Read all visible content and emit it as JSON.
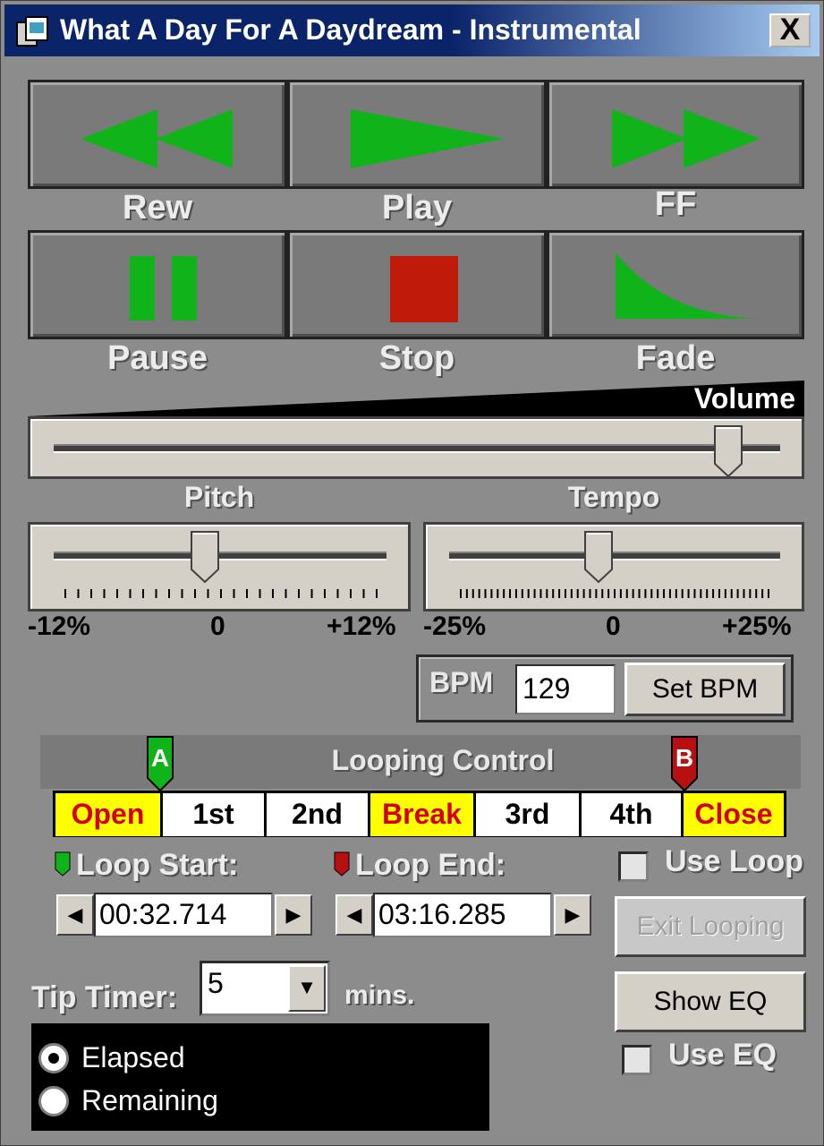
{
  "window": {
    "title": "What A Day For A Daydream - Instrumental",
    "close_label": "X"
  },
  "transport": {
    "rew_label": "Rew",
    "play_label": "Play",
    "ff_label": "FF",
    "pause_label": "Pause",
    "stop_label": "Stop",
    "fade_label": "Fade"
  },
  "volume": {
    "label": "Volume",
    "level": 0.97
  },
  "pitch": {
    "label": "Pitch",
    "min_label": "-12%",
    "mid_label": "0",
    "max_label": "+12%",
    "level": 0.5
  },
  "tempo": {
    "label": "Tempo",
    "min_label": "-25%",
    "mid_label": "0",
    "max_label": "+25%",
    "level": 0.5
  },
  "bpm": {
    "label": "BPM",
    "value": "129",
    "set_label": "Set BPM"
  },
  "looping": {
    "title": "Looping Control",
    "marker_a": "A",
    "marker_b": "B",
    "segments": [
      "Open",
      "1st",
      "2nd",
      "Break",
      "3rd",
      "4th",
      "Close"
    ],
    "loop_start_label": "Loop Start:",
    "loop_end_label": "Loop End:",
    "loop_start_value": "00:32.714",
    "loop_end_value": "03:16.285",
    "use_loop_label": "Use Loop",
    "exit_looping_label": "Exit Looping"
  },
  "tip_timer": {
    "label": "Tip Timer:",
    "value": "5",
    "unit": "mins."
  },
  "eq": {
    "show_label": "Show EQ",
    "use_label": "Use EQ"
  },
  "time_mode": {
    "elapsed_label": "Elapsed",
    "remaining_label": "Remaining",
    "selected": "Elapsed"
  },
  "colors": {
    "transport_green": "#11b31a",
    "stop_red": "#c01a0a",
    "highlight_yellow": "#ffff00",
    "highlight_text_red": "#d40000",
    "title_bar": "#0a246a"
  }
}
